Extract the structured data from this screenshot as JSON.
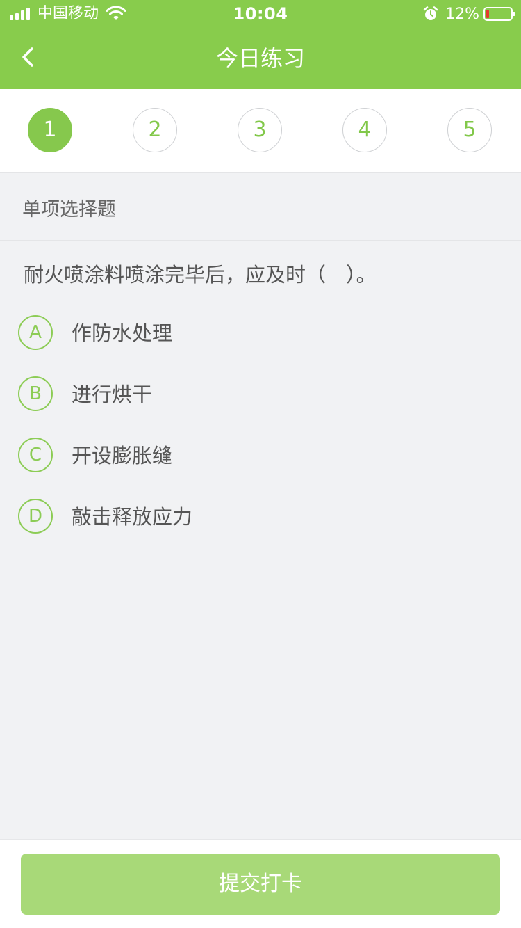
{
  "status_bar": {
    "carrier": "中国移动",
    "time": "10:04",
    "battery_percent": "12%",
    "battery_level": 0.12,
    "icons": [
      "signal-icon",
      "wifi-icon",
      "alarm-icon",
      "battery-icon"
    ]
  },
  "nav": {
    "title": "今日练习",
    "back_icon": "chevron-left-icon"
  },
  "steps": [
    "1",
    "2",
    "3",
    "4",
    "5"
  ],
  "active_step": "1",
  "question_type": "单项选择题",
  "question": "耐火喷涂料喷涂完毕后，应及时（　）。",
  "options": [
    {
      "letter": "A",
      "text": "作防水处理"
    },
    {
      "letter": "B",
      "text": "进行烘干"
    },
    {
      "letter": "C",
      "text": "开设膨胀缝"
    },
    {
      "letter": "D",
      "text": "敲击释放应力"
    }
  ],
  "submit_label": "提交打卡",
  "colors": {
    "brand_green": "#88cc4c",
    "active_step": "#86c84d",
    "submit_disabled": "#a8d978",
    "background": "#f1f2f4"
  }
}
